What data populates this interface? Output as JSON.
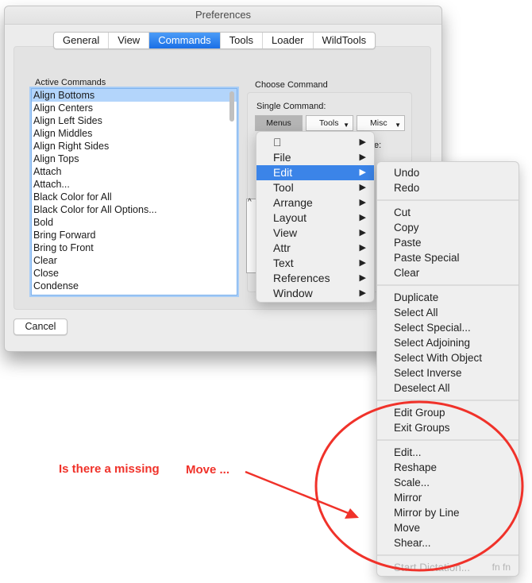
{
  "window": {
    "title": "Preferences"
  },
  "tabs": [
    {
      "label": "General",
      "active": false
    },
    {
      "label": "View",
      "active": false
    },
    {
      "label": "Commands",
      "active": true
    },
    {
      "label": "Tools",
      "active": false
    },
    {
      "label": "Loader",
      "active": false
    },
    {
      "label": "WildTools",
      "active": false
    }
  ],
  "active_commands": {
    "label": "Active Commands",
    "items": [
      "Align Bottoms",
      "Align Centers",
      "Align Left Sides",
      "Align Middles",
      "Align Right Sides",
      "Align Tops",
      "Attach",
      "Attach...",
      "Black Color for All",
      "Black Color for All Options...",
      "Bold",
      "Bring Forward",
      "Bring to Front",
      "Clear",
      "Close",
      "Condense"
    ],
    "selected_index": 0
  },
  "choose_command": {
    "label": "Choose Command",
    "single_label": "Single Command:",
    "segments": {
      "menus": "Menus",
      "tools": "Tools",
      "misc": "Misc"
    },
    "partial_label": "e:",
    "caret": "^"
  },
  "buttons": {
    "cancel": "Cancel"
  },
  "main_menu": {
    "items": [
      {
        "label": "",
        "icon": "apple-icon"
      },
      {
        "label": "File"
      },
      {
        "label": "Edit",
        "highlighted": true
      },
      {
        "label": "Tool"
      },
      {
        "label": "Arrange"
      },
      {
        "label": "Layout"
      },
      {
        "label": "View"
      },
      {
        "label": "Attr"
      },
      {
        "label": "Text"
      },
      {
        "label": "References"
      },
      {
        "label": "Window"
      }
    ],
    "submenu_arrow": "▶"
  },
  "edit_menu": {
    "groups": [
      [
        "Undo",
        "Redo"
      ],
      [
        "Cut",
        "Copy",
        "Paste",
        "Paste Special",
        "Clear"
      ],
      [
        "Duplicate",
        "Select All",
        "Select Special...",
        "Select Adjoining",
        "Select With Object",
        "Select Inverse",
        "Deselect All"
      ],
      [
        "Edit Group",
        "Exit Groups"
      ],
      [
        "Edit...",
        "Reshape",
        "Scale...",
        "Mirror",
        "Mirror by Line",
        "Move",
        "Shear..."
      ]
    ],
    "disabled_item": {
      "label": "Start Dictation...",
      "shortcut": "fn fn"
    }
  },
  "annotation": {
    "question": "Is there a missing",
    "highlight": "Move ...",
    "color": "#f0322a"
  }
}
